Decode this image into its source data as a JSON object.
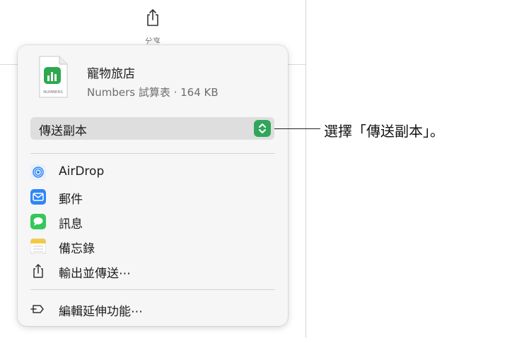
{
  "toolbar": {
    "share_icon": "share-icon",
    "share_label": "分享"
  },
  "popover": {
    "file": {
      "icon": "numbers-file-icon",
      "icon_caption": "NUMBERS",
      "name": "寵物旅店",
      "meta": "Numbers 試算表 · 164 KB"
    },
    "send_mode": {
      "selected": "傳送副本",
      "stepper_icon": "up-down-chevron-icon"
    },
    "items": [
      {
        "label": "AirDrop",
        "icon": "airdrop-icon",
        "color": "#2f86f6"
      },
      {
        "label": "郵件",
        "icon": "mail-icon",
        "color": "#2f86f6"
      },
      {
        "label": "訊息",
        "icon": "messages-icon",
        "color": "#34c759"
      },
      {
        "label": "備忘錄",
        "icon": "notes-icon",
        "color": "#f5c842"
      },
      {
        "label": "輸出並傳送⋯",
        "icon": "export-share-icon",
        "color": "#333333"
      }
    ],
    "extensions": {
      "label": "編輯延伸功能⋯",
      "icon": "extensions-icon"
    }
  },
  "callout": {
    "text": "選擇「傳送副本」。"
  },
  "colors": {
    "accent_green": "#31a65a",
    "popover_bg": "#f6f6f6"
  }
}
